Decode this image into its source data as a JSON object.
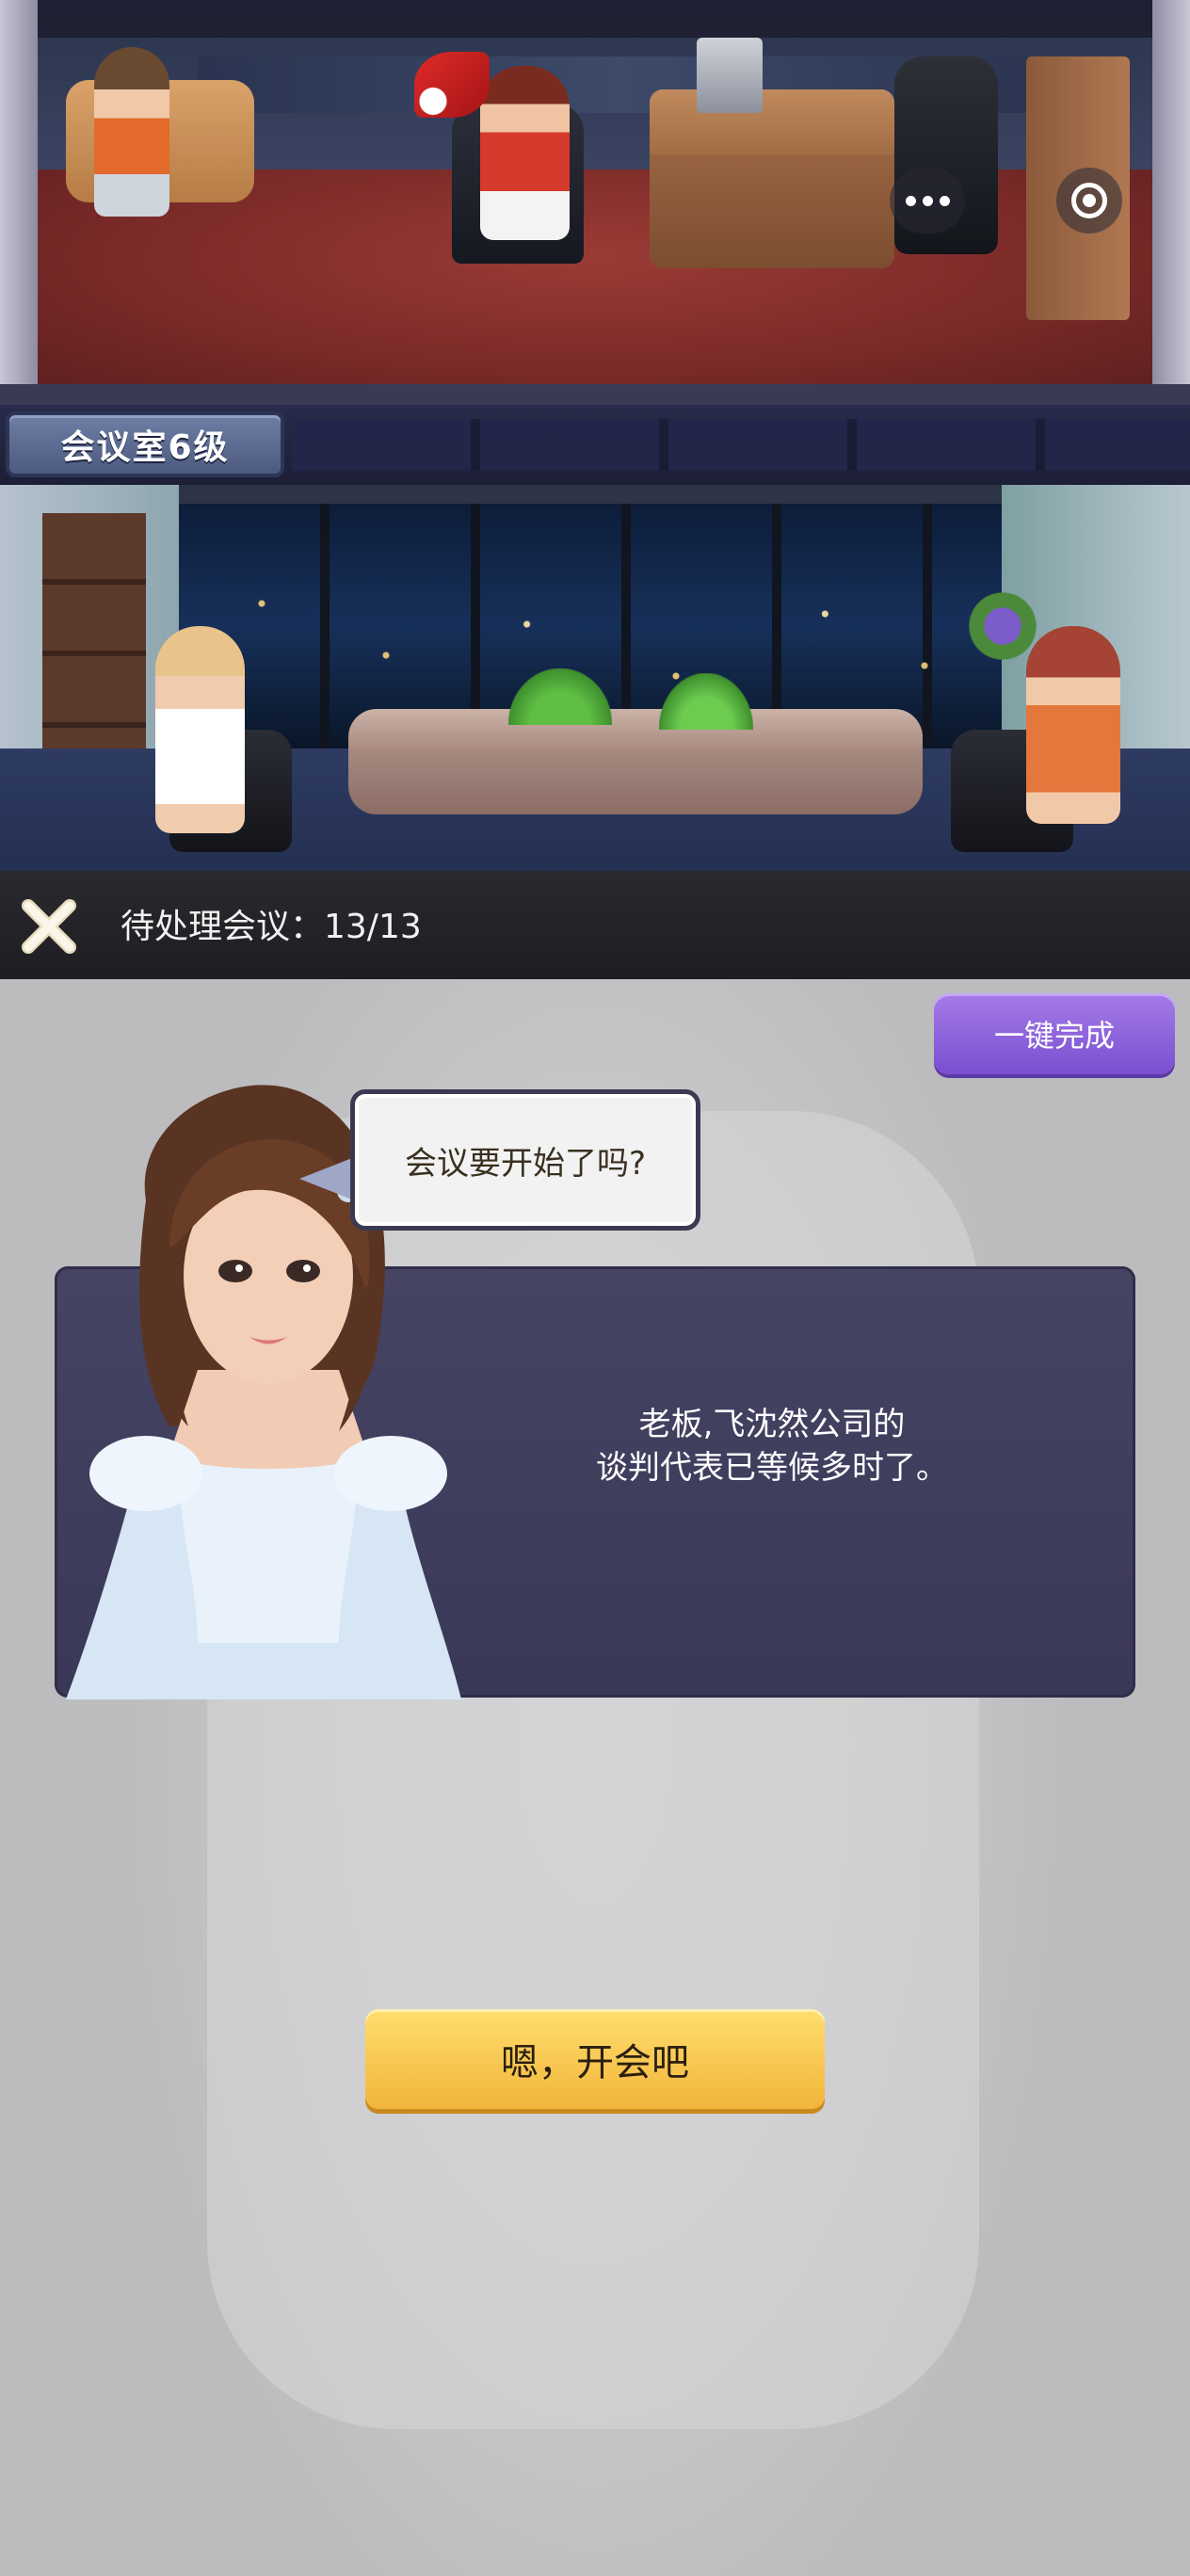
{
  "scene": {
    "room_level_label": "会议室6级"
  },
  "overlay_buttons": {
    "more_icon": "more-dots-icon",
    "target_icon": "target-icon"
  },
  "pending": {
    "label": "待处理会议：13/13",
    "close_icon": "close-x-icon"
  },
  "dialog": {
    "complete_all_label": "一键完成",
    "bubble_text": "会议要开始了吗?",
    "message_line1": "老板,飞沈然公司的",
    "message_line2": "谈判代表已等候多时了。",
    "confirm_label": "嗯，开会吧"
  },
  "colors": {
    "purple_button": "#8a5fe0",
    "yellow_button": "#f6c64a",
    "dialog_card": "#423f60",
    "panel_background": "#c8c8ca"
  }
}
